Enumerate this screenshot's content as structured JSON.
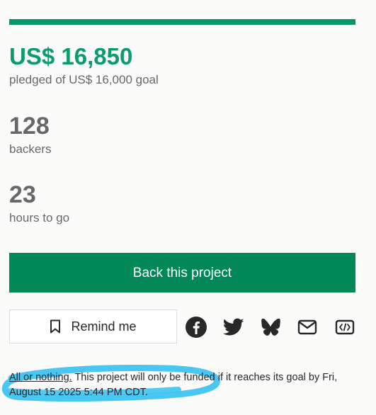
{
  "funding": {
    "progress_fraction": 1.0,
    "pledged_amount": "US$ 16,850",
    "pledged_sub": "pledged of US$ 16,000 goal",
    "backers_count": "128",
    "backers_label": "backers",
    "hours_count": "23",
    "hours_label": "hours to go"
  },
  "actions": {
    "back_label": "Back this project",
    "remind_label": "Remind me"
  },
  "share_icons": [
    "facebook-icon",
    "twitter-icon",
    "bluesky-icon",
    "email-icon",
    "embed-icon"
  ],
  "footer": {
    "link_text": "All or nothing.",
    "note_text": " This project will only be funded if it reaches its goal by Fri, August 15 2025 5:44 PM CDT."
  },
  "colors": {
    "accent": "#059669",
    "back_button": "#028858",
    "highlight": "#3fc3f0"
  }
}
